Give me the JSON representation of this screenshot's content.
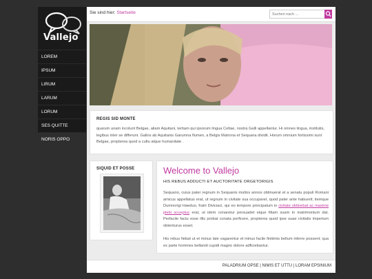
{
  "logo": {
    "text": "Vallejo"
  },
  "nav": {
    "items": [
      "LOREM",
      "IPSUM",
      "LIRUM",
      "LARUM",
      "LORUM",
      "SES QUITTE",
      "NORIS OPPO"
    ]
  },
  "breadcrumb": {
    "prefix": "Sie sind hier:",
    "current": "Startseite"
  },
  "search": {
    "placeholder": "Suchen nach ..."
  },
  "intro": {
    "title": "REGIS SID MONTE",
    "text": "quarum unam incolunt Belgae, aliam Aquitani, tertiam qui ipsorum lingua Celtae, nostra Galli appellantur. Hi omnes lingua, institutis, legibus inter se differunt. Gallos ab Aquitanis Garumna flumen, a Belgis Matrona et Sequana dividit. Horum omnium fortissimi sunt Belgae, propterea quod a cultu atque humanitate ."
  },
  "sidebox": {
    "title": "SIQUID ET POSSE"
  },
  "main": {
    "title": "Welcome to Vallejo",
    "subtitle": "HIS REBUS ADDUCTI ET AUCTORITATE ORGETORIGIS",
    "para1_a": "Sequano, cuius pater regnum in Sequanis multos annos obtinuerat et a senatu populi Romani amicus appellatus erat, ut regnum in civitate sua occuparet, quod pater ante habuerit; itemque Dumnorigi Haeduo, fratri Diviciaci, qui eo tempore principatum in",
    "para1_link": "civitate obtinebat ac maxime plebi acceptus",
    "para1_b": "erat, ut idem conaretur persuadet eique filiam suam in matrimonium dat. Perfacile factu esse illis probat conata perficere, propterea quod ipse suae civitatis imperium obtenturus esset.",
    "para2": "His rebus fiebat ut et minus late vagarentur et minus facile finitimis bellum inferre possent; qua ex parte homines bellandi cupidi magno dolore adficiebantur."
  },
  "footer": {
    "links": [
      "PALADRIUM OPSE",
      "NIMIS ET UTTU",
      "LORAM EPSINIUM"
    ],
    "separator": "|"
  },
  "colors": {
    "accent": "#c0399f",
    "sidebar": "#1a1a1a",
    "background": "#2e2e2e"
  },
  "icons": {
    "logo": "speech-bubbles-icon",
    "search": "search-icon"
  }
}
